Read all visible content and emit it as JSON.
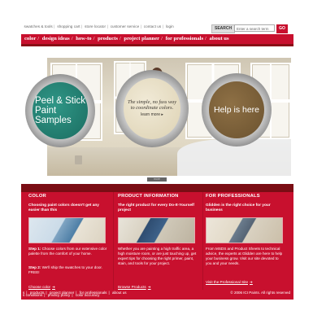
{
  "utility": {
    "links": [
      "swatches & tools",
      "shopping cart",
      "store locator",
      "customer service",
      "contact us",
      "login"
    ],
    "search_label": "SEARCH",
    "search_placeholder": "Enter a search term",
    "go_label": "GO"
  },
  "nav": {
    "items": [
      "color",
      "design ideas",
      "how-to",
      "products",
      "project planner",
      "for professionals",
      "about us"
    ]
  },
  "hero": {
    "can1": {
      "lines": [
        "Peel & Stick",
        "Paint",
        "Samples"
      ],
      "color": "#1f7d70"
    },
    "can2": {
      "lines": [
        "The simple, no fuss way",
        "to coordinate colors."
      ],
      "more": "learn more ▸",
      "color": "#e7dfc7"
    },
    "can3": {
      "text": "Help is here",
      "color": "#7b5f38"
    },
    "tag": "more"
  },
  "columns": [
    {
      "title": "COLOR",
      "subtitle": "Choosing paint colors doesn't get any easier than this",
      "steps": [
        {
          "label": "Step 1:",
          "text": "Choose colors from our extensive color palette from the comfort of your home."
        },
        {
          "label": "Step 2:",
          "text": "We'll ship the swatches to your door. FREE!"
        }
      ],
      "link": "Choose color"
    },
    {
      "title": "PRODUCT INFORMATION",
      "subtitle": "The right product for every Do-It-Yourself project",
      "body": "Whether you are painting a high traffic area, a high moisture room, or are just touching up, get expert tips for choosing the right primer, paint, stain, and tools for your project.",
      "link": "Browse Products"
    },
    {
      "title": "FOR PROFESSIONALS",
      "subtitle": "Glidden is the right choice for your business",
      "body": "From MSDS and Product Sheets to technical advice, the experts at Glidden are here to help your business grow. Visit our site devoted to you and your needs.",
      "link": "Visit the Professional Site"
    }
  ],
  "footer": {
    "links": [
      "s conditions",
      "privacy policy",
      "color accuracy",
      "s",
      "products",
      "project planner",
      "for professionals",
      "about us"
    ],
    "copyright": "© 2006 ICI Paints. All rights reserved"
  },
  "colors": {
    "brand_red": "#c8102e",
    "dark_red": "#7a0d14"
  }
}
